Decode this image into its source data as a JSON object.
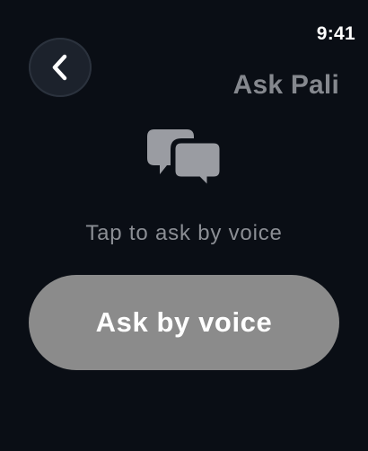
{
  "status_bar": {
    "time": "9:41"
  },
  "header": {
    "back_icon": "chevron-left-icon",
    "title": "Ask Pali"
  },
  "main": {
    "icon": "chat-bubbles-icon",
    "hint": "Tap to ask by voice",
    "ask_button_label": "Ask by voice"
  },
  "colors": {
    "background": "#0a0e15",
    "button": "#8b8b8b",
    "muted_text": "#8b8e94",
    "icon": "#9a9ca2"
  }
}
